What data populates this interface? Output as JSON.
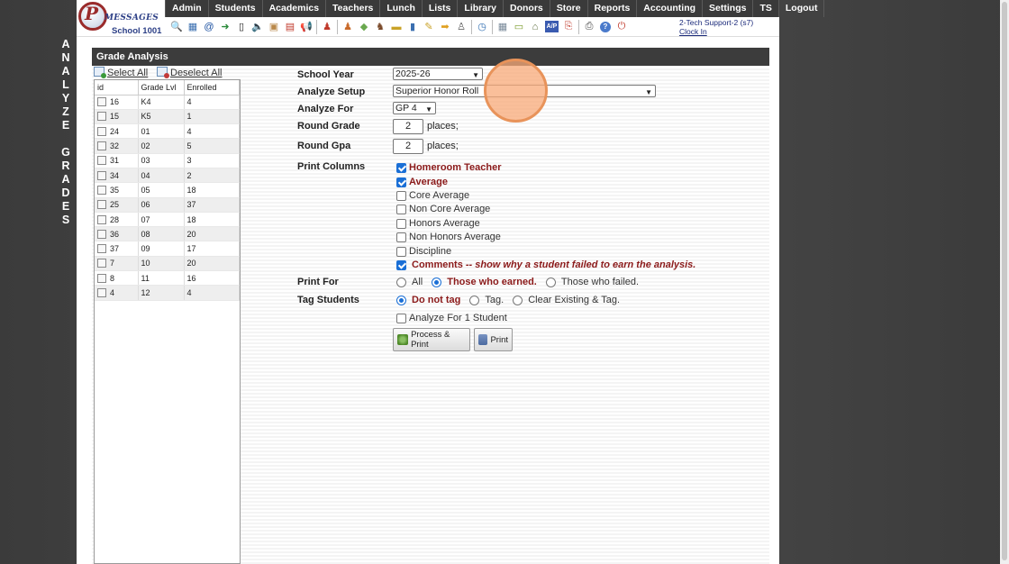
{
  "side_title": {
    "line1": [
      "A",
      "N",
      "A",
      "L",
      "Y",
      "Z",
      "E"
    ],
    "line2": [
      "G",
      "R",
      "A",
      "D",
      "E",
      "S"
    ]
  },
  "logo": {
    "letter": "P",
    "text": "MESSAGES",
    "school": "School 1001"
  },
  "menu": [
    "Admin",
    "Students",
    "Academics",
    "Teachers",
    "Lunch",
    "Lists",
    "Library",
    "Donors",
    "Store",
    "Reports",
    "Accounting",
    "Settings",
    "TS",
    "Logout"
  ],
  "toolbar_icons": [
    {
      "name": "search-icon",
      "glyph": "🔍",
      "color": "#5b6d8a"
    },
    {
      "name": "calendar-grid-icon",
      "glyph": "▦",
      "color": "#3b6fb0"
    },
    {
      "name": "email-icon",
      "glyph": "@",
      "color": "#1a4fa0"
    },
    {
      "name": "arrow-icon",
      "glyph": "➜",
      "color": "#2a8a3a"
    },
    {
      "name": "phone-icon",
      "glyph": "▯",
      "color": "#222"
    },
    {
      "name": "speaker-icon",
      "glyph": "🔈",
      "color": "#555"
    },
    {
      "name": "image-icon",
      "glyph": "▣",
      "color": "#b9884a"
    },
    {
      "name": "calendar-icon",
      "glyph": "▤",
      "color": "#c0392b"
    },
    {
      "name": "megaphone-icon",
      "glyph": "📢",
      "color": "#c0392b"
    },
    {
      "name": "teacher-icon",
      "glyph": "♟",
      "color": "#c0392b"
    },
    {
      "name": "student-icon",
      "glyph": "♟",
      "color": "#c96a2a"
    },
    {
      "name": "tag-icon",
      "glyph": "◆",
      "color": "#6aa84f"
    },
    {
      "name": "group-icon",
      "glyph": "♞",
      "color": "#7a4a2a"
    },
    {
      "name": "card-icon",
      "glyph": "▬",
      "color": "#c9a227"
    },
    {
      "name": "book-icon",
      "glyph": "▮",
      "color": "#3b6fb0"
    },
    {
      "name": "pencil-icon",
      "glyph": "✎",
      "color": "#c9a227"
    },
    {
      "name": "forward-icon",
      "glyph": "➡",
      "color": "#e0a020"
    },
    {
      "name": "people-icon",
      "glyph": "♙",
      "color": "#555"
    },
    {
      "name": "clock-icon",
      "glyph": "◷",
      "color": "#2a6ab0"
    },
    {
      "name": "table-icon",
      "glyph": "▦",
      "color": "#7a8a9a"
    },
    {
      "name": "ruler-icon",
      "glyph": "▭",
      "color": "#7a9a2a"
    },
    {
      "name": "bank-icon",
      "glyph": "⌂",
      "color": "#5a6a3a"
    },
    {
      "name": "ap-icon",
      "glyph": "A/P",
      "color": "#fff"
    },
    {
      "name": "pdf-icon",
      "glyph": "⎘",
      "color": "#c0392b"
    },
    {
      "name": "printer-icon",
      "glyph": "⎙",
      "color": "#444"
    },
    {
      "name": "help-icon",
      "glyph": "?",
      "color": "#fff"
    },
    {
      "name": "power-icon",
      "glyph": "⏻",
      "color": "#c0392b"
    }
  ],
  "support": {
    "user": "2-Tech Support-2 (s7)",
    "clock_in": "Clock In"
  },
  "panel_title": "Grade Analysis",
  "select_all": "Select All",
  "deselect_all": "Deselect All",
  "grade_table": {
    "headers": [
      "id",
      "Grade Lvl",
      "Enrolled"
    ],
    "rows": [
      [
        "16",
        "K4",
        "4"
      ],
      [
        "15",
        "K5",
        "1"
      ],
      [
        "24",
        "01",
        "4"
      ],
      [
        "32",
        "02",
        "5"
      ],
      [
        "31",
        "03",
        "3"
      ],
      [
        "34",
        "04",
        "2"
      ],
      [
        "35",
        "05",
        "18"
      ],
      [
        "25",
        "06",
        "37"
      ],
      [
        "28",
        "07",
        "18"
      ],
      [
        "36",
        "08",
        "20"
      ],
      [
        "37",
        "09",
        "17"
      ],
      [
        "7",
        "10",
        "20"
      ],
      [
        "8",
        "11",
        "16"
      ],
      [
        "4",
        "12",
        "4"
      ]
    ]
  },
  "form": {
    "school_year": {
      "label": "School Year",
      "value": "2025-26"
    },
    "analyze_setup": {
      "label": "Analyze Setup",
      "value": "Superior Honor Roll"
    },
    "analyze_for": {
      "label": "Analyze For",
      "value": "GP 4"
    },
    "round_grade": {
      "label": "Round Grade",
      "value": "2",
      "suffix": "places;"
    },
    "round_gpa": {
      "label": "Round Gpa",
      "value": "2",
      "suffix": "places;"
    },
    "print_columns": {
      "label": "Print Columns",
      "items": [
        {
          "label": "Homeroom Teacher",
          "checked": true
        },
        {
          "label": "Average",
          "checked": true
        },
        {
          "label": "Core Average",
          "checked": false
        },
        {
          "label": "Non Core Average",
          "checked": false
        },
        {
          "label": "Honors Average",
          "checked": false
        },
        {
          "label": "Non Honors Average",
          "checked": false
        },
        {
          "label": "Discipline",
          "checked": false
        },
        {
          "label": "Comments",
          "checked": true,
          "note": "-- show why a student failed to earn the analysis."
        }
      ]
    },
    "print_for": {
      "label": "Print For",
      "options": [
        "All",
        "Those who earned.",
        "Those who failed."
      ],
      "selected": 1
    },
    "tag_students": {
      "label": "Tag Students",
      "options": [
        "Do not tag",
        "Tag.",
        "Clear Existing & Tag."
      ],
      "selected": 0
    },
    "analyze_one": {
      "label": "Analyze For 1 Student",
      "checked": false
    },
    "process_button": "Process & Print",
    "print_button": "Print"
  }
}
